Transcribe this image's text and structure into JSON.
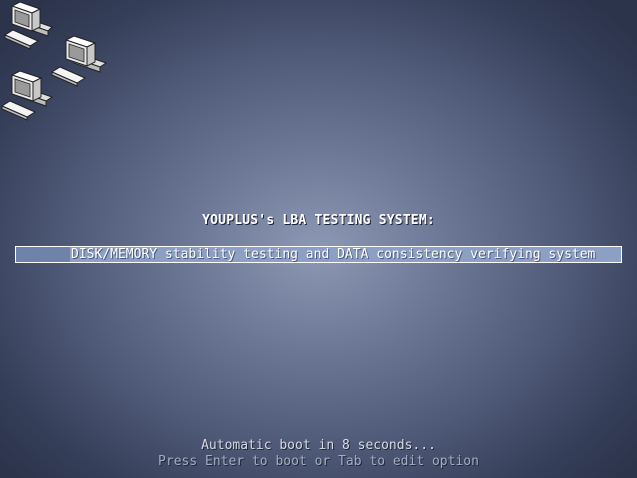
{
  "logo": {
    "icon": "networked-computers-icon"
  },
  "menu": {
    "title": "YOUPLUS's LBA TESTING SYSTEM:",
    "items": [
      {
        "label": "DISK/MEMORY stability testing and DATA consistency verifying system",
        "selected": true
      }
    ]
  },
  "footer": {
    "countdown": "Automatic boot in 8 seconds...",
    "help": "Press Enter to boot or Tab to edit option"
  },
  "colors": {
    "highlight": "#8c9fc4",
    "background_center": "#8d98b4",
    "background_edge": "#2c344c"
  }
}
